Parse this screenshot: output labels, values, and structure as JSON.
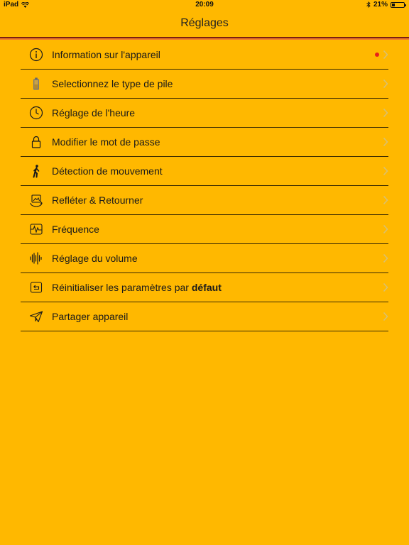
{
  "status_bar": {
    "device": "iPad",
    "time": "20:09",
    "battery": "21%",
    "battery_level": 0.21
  },
  "header": {
    "title": "Réglages"
  },
  "colors": {
    "background": "#FFB800",
    "accent_line_dark": "#7a1f10",
    "accent_line_light": "#f07a2a",
    "badge": "#e8201a"
  },
  "settings": {
    "items": [
      {
        "label": "Information sur l'appareil",
        "icon": "info-icon",
        "badge": true
      },
      {
        "label": "Selectionnez le type de pile",
        "icon": "battery-icon"
      },
      {
        "label": "Réglage de l'heure",
        "icon": "clock-icon"
      },
      {
        "label": "Modifier le mot de passe",
        "icon": "lock-icon"
      },
      {
        "label": "Détection de mouvement",
        "icon": "walking-person-icon"
      },
      {
        "label": "Refléter & Retourner",
        "icon": "flip-rotate-icon"
      },
      {
        "label": "Fréquence",
        "icon": "waveform-frequency-icon"
      },
      {
        "label": "Réglage du volume",
        "icon": "sound-bars-icon"
      },
      {
        "label_pre": "Réinitialiser les paramètres par ",
        "label_bold": "défaut",
        "icon": "reset-icon"
      },
      {
        "label": "Partager appareil",
        "icon": "paper-plane-icon"
      }
    ]
  }
}
